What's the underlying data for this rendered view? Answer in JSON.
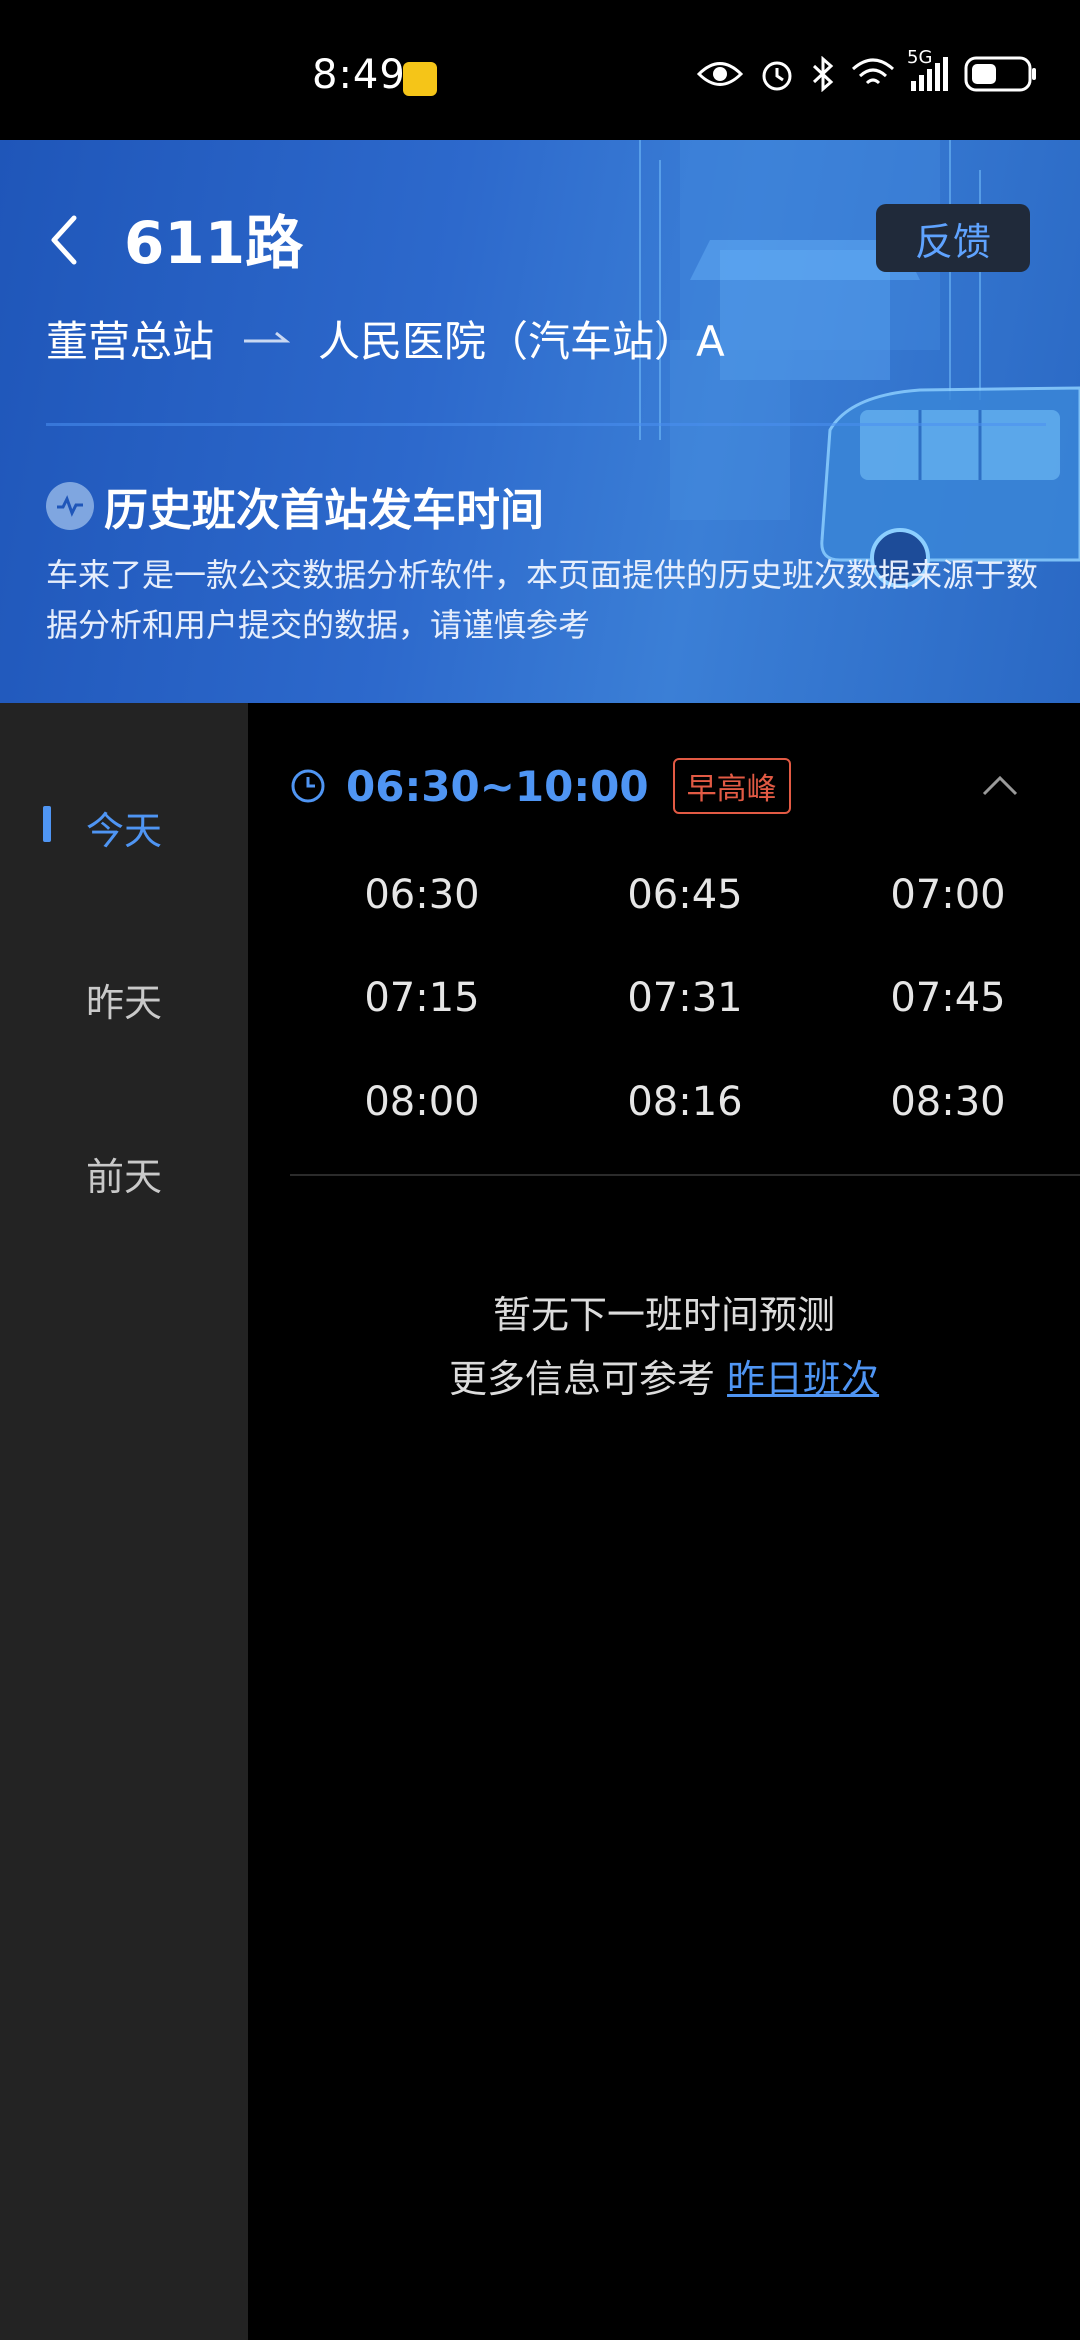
{
  "status_bar": {
    "time": "8:49",
    "network": "5G",
    "icons": [
      "eye-icon",
      "alarm-icon",
      "bluetooth-icon",
      "wifi-icon",
      "signal-icon",
      "battery-icon"
    ]
  },
  "header": {
    "title": "611路",
    "feedback_label": "反馈",
    "route_from": "董营总站",
    "route_to": "人民医院（汽车站）A",
    "section_title": "历史班次首站发车时间",
    "description": "车来了是一款公交数据分析软件，本页面提供的历史班次数据来源于数据分析和用户提交的数据，请谨慎参考"
  },
  "sidebar": {
    "items": [
      {
        "label": "今天",
        "active": true
      },
      {
        "label": "昨天",
        "active": false
      },
      {
        "label": "前天",
        "active": false
      }
    ]
  },
  "schedule": {
    "range": "06:30~10:00",
    "badge": "早高峰",
    "times": [
      "06:30",
      "06:45",
      "07:00",
      "07:15",
      "07:31",
      "07:45",
      "08:00",
      "08:16",
      "08:30"
    ]
  },
  "notice": {
    "line1": "暂无下一班时间预测",
    "line2_prefix": "更多信息可参考",
    "link_label": "昨日班次"
  },
  "colors": {
    "accent": "#4f95f3",
    "peak": "#e25a44",
    "sidebar_bg": "#232323",
    "header_bg": "#2d69cc"
  }
}
